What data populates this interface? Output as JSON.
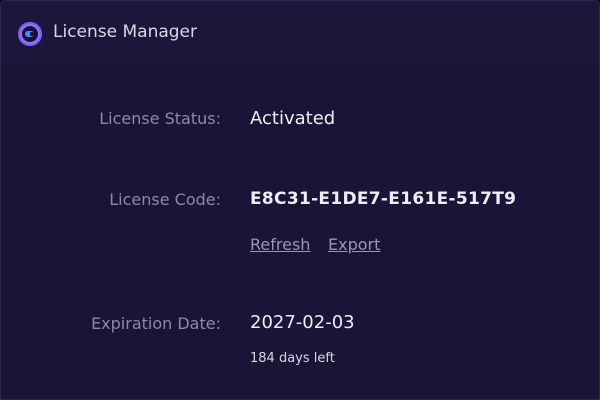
{
  "window": {
    "title": "License Manager",
    "icon": "app-logo-icon"
  },
  "license": {
    "status_label": "License Status:",
    "status_value": "Activated",
    "code_label": "License Code:",
    "code_value": "E8C31-E1DE7-E161E-517T9",
    "refresh_label": "Refresh",
    "export_label": "Export",
    "expiration_label": "Expiration Date:",
    "expiration_value": "2027-02-03",
    "days_left": "184 days left"
  },
  "colors": {
    "background": "#1a1536",
    "accent": "#8f74ff",
    "label": "#8c8aa6",
    "value": "#eeedf5"
  }
}
